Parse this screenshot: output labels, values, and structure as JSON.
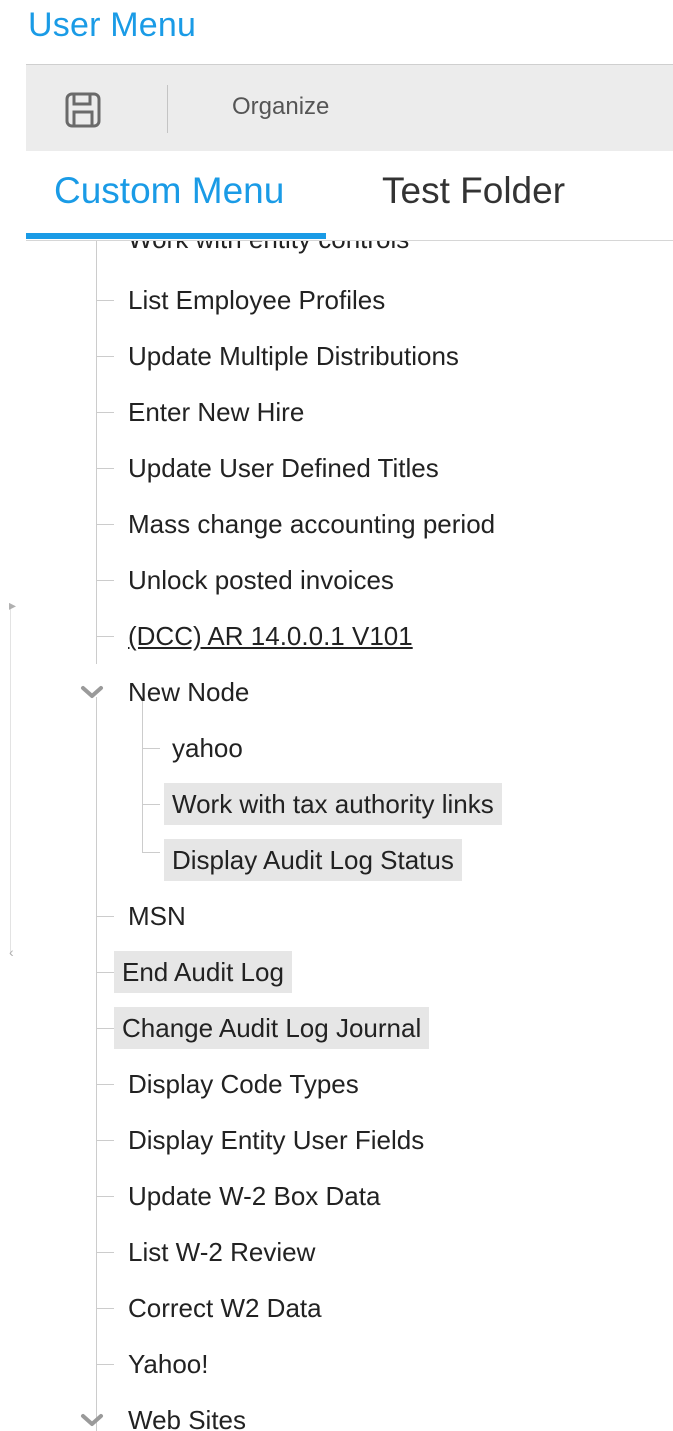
{
  "header": {
    "title": "User Menu"
  },
  "toolbar": {
    "save_icon": "save-icon",
    "organize_label": "Organize"
  },
  "tabs": [
    {
      "label": "Custom Menu",
      "active": true
    },
    {
      "label": "Test Folder",
      "active": false
    }
  ],
  "tree": {
    "clipped_item_label": "Work with entity controls",
    "items": [
      "List Employee Profiles",
      "Update Multiple Distributions",
      "Enter New Hire",
      "Update User Defined Titles",
      "Mass change accounting period",
      "Unlock posted invoices",
      "(DCC) AR 14.0.0.1 V101"
    ],
    "new_node": {
      "label": "New Node",
      "expanded": true,
      "children": [
        "yahoo",
        "Work with tax authority links",
        "Display Audit Log Status"
      ]
    },
    "items_after": [
      "MSN",
      "End Audit Log",
      "Change Audit Log Journal",
      "Display Code Types",
      "Display Entity User Fields",
      "Update W-2 Box Data",
      "List W-2 Review",
      "Correct W2 Data",
      "Yahoo!"
    ],
    "web_sites": {
      "label": "Web Sites",
      "expanded": true
    }
  },
  "colors": {
    "accent": "#1a9be6",
    "selected_background": "#e6e6e6",
    "toolbar_background": "#ececec"
  }
}
